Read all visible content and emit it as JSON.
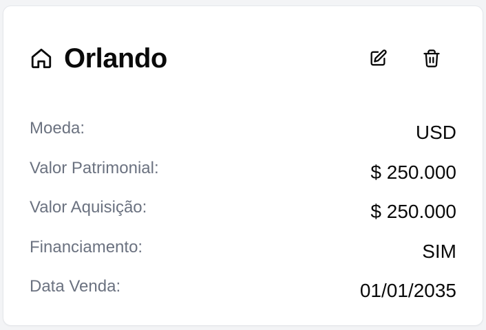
{
  "card": {
    "title": "Orlando",
    "title_icon": "home-icon",
    "actions": {
      "edit_icon": "edit-icon",
      "delete_icon": "trash-icon"
    },
    "rows": [
      {
        "label": "Moeda:",
        "value": "USD"
      },
      {
        "label": "Valor Patrimonial:",
        "value": "$ 250.000"
      },
      {
        "label": "Valor Aquisição:",
        "value": "$ 250.000"
      },
      {
        "label": "Financiamento:",
        "value": "SIM"
      },
      {
        "label": "Data Venda:",
        "value": "01/01/2035"
      }
    ]
  },
  "colors": {
    "card_bg": "#ffffff",
    "page_bg": "#f3f4f6",
    "label": "#6b7280",
    "value": "#0a0a0a",
    "border": "#e5e7eb"
  }
}
